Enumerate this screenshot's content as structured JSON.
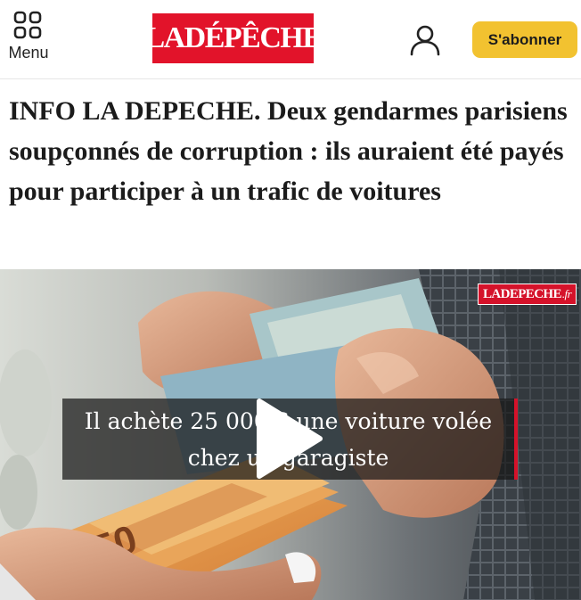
{
  "header": {
    "menu_label": "Menu",
    "logo_text": "LADÉPÊCHE",
    "subscribe_label": "S'abonner",
    "subscribe_color": "#f2c230",
    "brand_color": "#e2132a",
    "icons": [
      "grid-menu-icon",
      "user-icon"
    ]
  },
  "article": {
    "headline": "INFO LA DEPECHE. Deux gendarmes parisiens soupçonnés de corruption : ils auraient été payés pour participer à un trafic de voitures"
  },
  "video": {
    "watermark_main": "LADEPECHE",
    "watermark_suffix": ".fr",
    "caption_line1": "Il achète 25 000 € une voiture volée",
    "caption_line2": "chez un garagiste",
    "play_icon": "play-icon",
    "banknote_label": "50"
  }
}
